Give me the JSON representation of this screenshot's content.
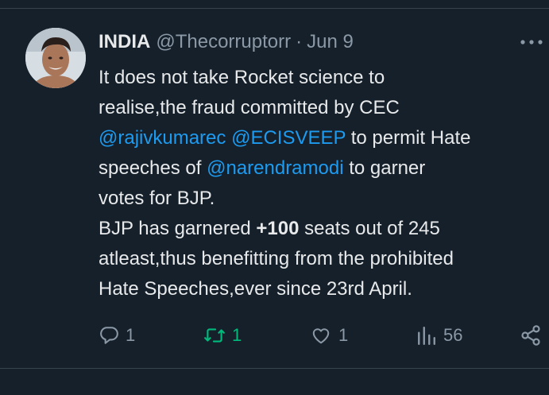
{
  "tweet": {
    "author_name": "INDIA",
    "handle": "@Thecorruptorr",
    "separator": "·",
    "date": "Jun 9",
    "lines": [
      {
        "parts": [
          {
            "t": "text",
            "v": "It does not take Rocket science to"
          }
        ]
      },
      {
        "parts": [
          {
            "t": "text",
            "v": "realise,the fraud committed by CEC"
          }
        ]
      },
      {
        "parts": [
          {
            "t": "mention",
            "v": "@rajivkumarec"
          },
          {
            "t": "text",
            "v": " "
          },
          {
            "t": "mention",
            "v": "@ECISVEEP"
          },
          {
            "t": "text",
            "v": " to permit Hate"
          }
        ]
      },
      {
        "parts": [
          {
            "t": "text",
            "v": "speeches of "
          },
          {
            "t": "mention",
            "v": "@narendramodi"
          },
          {
            "t": "text",
            "v": " to garner"
          }
        ]
      },
      {
        "parts": [
          {
            "t": "text",
            "v": "votes for BJP."
          }
        ]
      },
      {
        "parts": [
          {
            "t": "text",
            "v": "BJP has garnered "
          },
          {
            "t": "bold",
            "v": "+100"
          },
          {
            "t": "text",
            "v": " seats out of 245"
          }
        ]
      },
      {
        "parts": [
          {
            "t": "text",
            "v": "atleast,thus benefitting from the prohibited"
          }
        ]
      },
      {
        "parts": [
          {
            "t": "text",
            "v": "Hate Speeches,ever since 23rd April."
          }
        ]
      }
    ]
  },
  "actions": {
    "reply": {
      "count": "1",
      "icon": "reply-icon"
    },
    "retweet": {
      "count": "1",
      "icon": "retweet-icon",
      "color": "#00ba7c"
    },
    "like": {
      "count": "1",
      "icon": "heart-icon"
    },
    "views": {
      "count": "56",
      "icon": "views-icon"
    },
    "share": {
      "icon": "share-icon"
    }
  },
  "more_icon": "more-icon"
}
